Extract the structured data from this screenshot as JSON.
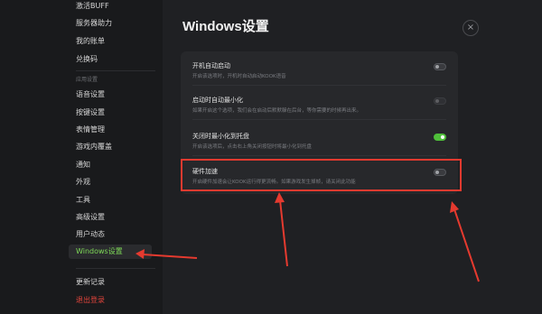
{
  "sidebar": {
    "items_top": [
      {
        "label": "激活BUFF"
      },
      {
        "label": "服务器助力"
      },
      {
        "label": "我的账单"
      },
      {
        "label": "兑换码"
      }
    ],
    "section_label": "应用设置",
    "items": [
      {
        "label": "语音设置"
      },
      {
        "label": "按键设置"
      },
      {
        "label": "表情管理"
      },
      {
        "label": "游戏内覆盖"
      },
      {
        "label": "通知"
      },
      {
        "label": "外观"
      },
      {
        "label": "工具"
      },
      {
        "label": "高级设置"
      },
      {
        "label": "用户动态"
      },
      {
        "label": "Windows设置"
      }
    ],
    "bottom": [
      {
        "label": "更新记录"
      },
      {
        "label": "退出登录"
      }
    ],
    "active_color": "#7ed957",
    "danger_color": "#e0443b"
  },
  "main": {
    "title": "Windows设置",
    "close_icon": "×",
    "settings": [
      {
        "title": "开机自动启动",
        "desc": "开启该选项时，开机时自动启动KOOK语音",
        "toggle": "off"
      },
      {
        "title": "启动时自动最小化",
        "desc": "如果开启这个选项，我们会在启动后默默躲在后台，等你需要的时候再出来。",
        "toggle": "disabled"
      },
      {
        "title": "关闭时最小化到托盘",
        "desc": "开启该选项后，点击右上角关闭按钮时将最小化到托盘",
        "toggle": "on"
      },
      {
        "title": "硬件加速",
        "desc": "开启硬件加速会让KOOK运行得更流畅。如果游戏发生掉帧，请关闭此功能",
        "toggle": "off"
      }
    ]
  },
  "annotation_color": "#e53a2f"
}
